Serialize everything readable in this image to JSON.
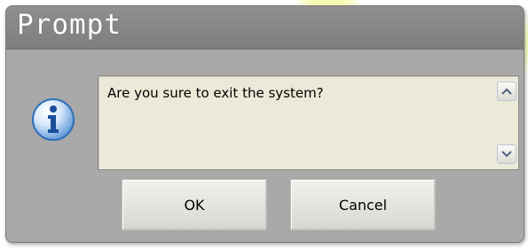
{
  "dialog": {
    "title": "Prompt",
    "message": "Are you sure to exit the system?",
    "icon": "info-icon",
    "ok_label": "OK",
    "cancel_label": "Cancel"
  },
  "colors": {
    "titlebar": "#858585",
    "body": "#a9a9a9",
    "message_bg": "#ece9d8",
    "info_icon_blue": "#2f6fb8"
  }
}
